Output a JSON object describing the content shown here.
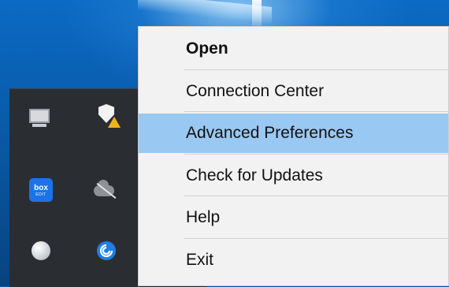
{
  "menu": {
    "items": [
      {
        "label": "Open"
      },
      {
        "label": "Connection Center"
      },
      {
        "label": "Advanced Preferences"
      },
      {
        "label": "Check for Updates"
      },
      {
        "label": "Help"
      },
      {
        "label": "Exit"
      }
    ],
    "highlighted_index": 2
  },
  "tray": {
    "icons": [
      "computer-icon",
      "shield-warning-icon",
      "box-edit-icon",
      "onedrive-offline-icon",
      "globe-icon",
      "citrix-receiver-icon"
    ],
    "box_icon_text": "box",
    "box_icon_subtext": "EDIT"
  },
  "colors": {
    "desktop": "#0a5fae",
    "menu_background": "#f2f2f2",
    "highlight": "#99c8f2",
    "tray_background": "#2a2e33"
  }
}
